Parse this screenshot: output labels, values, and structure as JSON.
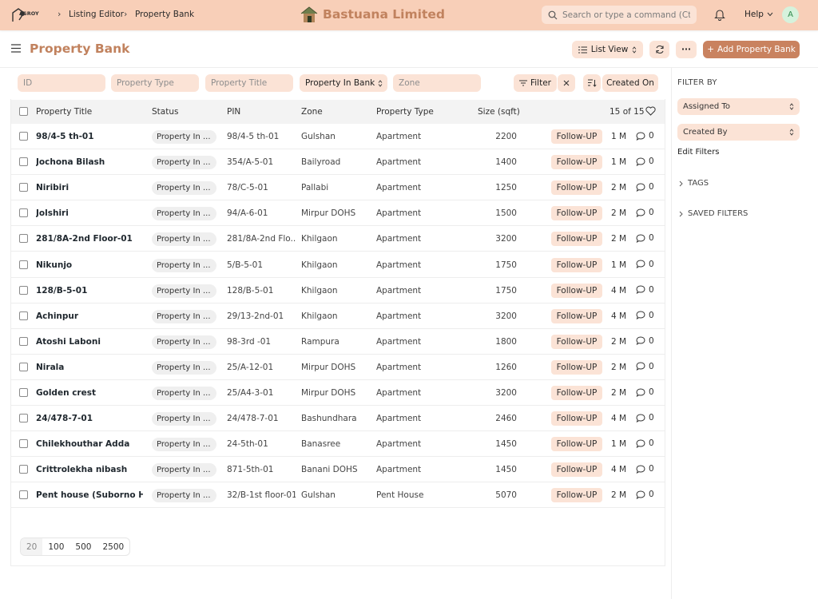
{
  "navbar": {
    "logo_text": "ASROY",
    "breadcrumb": [
      "Listing Editor",
      "Property Bank"
    ],
    "brand": "Bastuana Limited",
    "search_placeholder": "Search or type a command (Ctrl + G)",
    "help_label": "Help",
    "avatar_letter": "A"
  },
  "page": {
    "title": "Property Bank",
    "list_view_label": "List View",
    "add_label": "Add Property Bank"
  },
  "filters": {
    "id_placeholder": "ID",
    "property_type_placeholder": "Property Type",
    "property_title_placeholder": "Property Title",
    "status_value": "Property In Bank",
    "zone_placeholder": "Zone",
    "filter_label": "Filter",
    "sort_label": "Created On"
  },
  "table": {
    "headers": {
      "title": "Property Title",
      "status": "Status",
      "pin": "PIN",
      "zone": "Zone",
      "type": "Property Type",
      "size": "Size (sqft)",
      "count": "15 of 15"
    },
    "rows": [
      {
        "title": "98/4-5 th-01",
        "status": "Property In ...",
        "pin": "98/4-5 th-01",
        "zone": "Gulshan",
        "type": "Apartment",
        "size": "2200",
        "action": "Follow-UP",
        "age": "1 M",
        "comments": "0"
      },
      {
        "title": "Jochona Bilash",
        "status": "Property In ...",
        "pin": "354/A-5-01",
        "zone": "Bailyroad",
        "type": "Apartment",
        "size": "1400",
        "action": "Follow-UP",
        "age": "1 M",
        "comments": "0"
      },
      {
        "title": "Niribiri",
        "status": "Property In ...",
        "pin": "78/C-5-01",
        "zone": "Pallabi",
        "type": "Apartment",
        "size": "1250",
        "action": "Follow-UP",
        "age": "2 M",
        "comments": "0"
      },
      {
        "title": "Jolshiri",
        "status": "Property In ...",
        "pin": "94/A-6-01",
        "zone": "Mirpur DOHS",
        "type": "Apartment",
        "size": "1500",
        "action": "Follow-UP",
        "age": "2 M",
        "comments": "0"
      },
      {
        "title": "281/8A-2nd Floor-01",
        "status": "Property In ...",
        "pin": "281/8A-2nd Flo...",
        "zone": "Khilgaon",
        "type": "Apartment",
        "size": "3200",
        "action": "Follow-UP",
        "age": "2 M",
        "comments": "0"
      },
      {
        "title": "Nikunjo",
        "status": "Property In ...",
        "pin": "5/B-5-01",
        "zone": "Khilgaon",
        "type": "Apartment",
        "size": "1750",
        "action": "Follow-UP",
        "age": "1 M",
        "comments": "0"
      },
      {
        "title": "128/B-5-01",
        "status": "Property In ...",
        "pin": "128/B-5-01",
        "zone": "Khilgaon",
        "type": "Apartment",
        "size": "1750",
        "action": "Follow-UP",
        "age": "4 M",
        "comments": "0"
      },
      {
        "title": "Achinpur",
        "status": "Property In ...",
        "pin": "29/13-2nd-01",
        "zone": "Khilgaon",
        "type": "Apartment",
        "size": "3200",
        "action": "Follow-UP",
        "age": "4 M",
        "comments": "0"
      },
      {
        "title": "Atoshi Laboni",
        "status": "Property In ...",
        "pin": "98-3rd -01",
        "zone": "Rampura",
        "type": "Apartment",
        "size": "1800",
        "action": "Follow-UP",
        "age": "2 M",
        "comments": "0"
      },
      {
        "title": "Nirala",
        "status": "Property In ...",
        "pin": "25/A-12-01",
        "zone": "Mirpur DOHS",
        "type": "Apartment",
        "size": "1260",
        "action": "Follow-UP",
        "age": "2 M",
        "comments": "0"
      },
      {
        "title": "Golden crest",
        "status": "Property In ...",
        "pin": "25/A4-3-01",
        "zone": "Mirpur DOHS",
        "type": "Apartment",
        "size": "3200",
        "action": "Follow-UP",
        "age": "2 M",
        "comments": "0"
      },
      {
        "title": "24/478-7-01",
        "status": "Property In ...",
        "pin": "24/478-7-01",
        "zone": "Bashundhara",
        "type": "Apartment",
        "size": "2460",
        "action": "Follow-UP",
        "age": "4 M",
        "comments": "0"
      },
      {
        "title": "Chilekhouthar Adda",
        "status": "Property In ...",
        "pin": "24-5th-01",
        "zone": "Banasree",
        "type": "Apartment",
        "size": "1450",
        "action": "Follow-UP",
        "age": "1 M",
        "comments": "0"
      },
      {
        "title": "Crittrolekha nibash",
        "status": "Property In ...",
        "pin": "871-5th-01",
        "zone": "Banani DOHS",
        "type": "Apartment",
        "size": "1450",
        "action": "Follow-UP",
        "age": "4 M",
        "comments": "0"
      },
      {
        "title": "Pent house (Suborno Heights)",
        "status": "Property In ...",
        "pin": "32/B-1st floor-01",
        "zone": "Gulshan",
        "type": "Pent House",
        "size": "5070",
        "action": "Follow-UP",
        "age": "2 M",
        "comments": "0"
      }
    ]
  },
  "paging": [
    "20",
    "100",
    "500",
    "2500"
  ],
  "sidebar": {
    "filter_by": "FILTER BY",
    "assigned_to": "Assigned To",
    "created_by": "Created By",
    "edit_filters": "Edit Filters",
    "tags": "TAGS",
    "saved_filters": "SAVED FILTERS"
  },
  "colors": {
    "navbar_bg": "#f8cfb8",
    "accent": "#c1825e",
    "control_bg": "#fbe3d6",
    "primary_button": "#c9825f"
  }
}
